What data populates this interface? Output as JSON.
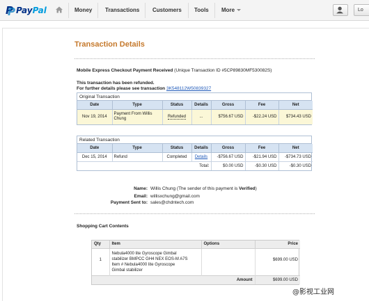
{
  "nav": {
    "logo_pay": "Pay",
    "logo_pal": "Pal",
    "items": [
      "Money",
      "Transactions",
      "Customers",
      "Tools",
      "More"
    ],
    "logout_label": "Lo"
  },
  "page": {
    "title": "Transaction Details",
    "received_bold": "Mobile Express Checkout Payment Received",
    "received_rest": " (Unique Transaction ID #5CP89830MF530082S)",
    "refunded_note": "This transaction has been refunded.",
    "further_details": "For further details please see transaction ",
    "refund_txn_link": "3K548112W50839327"
  },
  "original": {
    "caption": "Original Transaction",
    "headers": [
      "Date",
      "Type",
      "Status",
      "Details",
      "Gross",
      "Fee",
      "Net"
    ],
    "row": {
      "date": "Nov 19, 2014",
      "type_line1": "Payment From Willis",
      "type_line2": "Chung",
      "status": "Refunded",
      "details": "...",
      "gross": "$756.67 USD",
      "fee": "-$22.24 USD",
      "net": "$734.43 USD"
    }
  },
  "related": {
    "caption": "Related Transaction",
    "headers": [
      "Date",
      "Type",
      "Status",
      "Details",
      "Gross",
      "Fee",
      "Net"
    ],
    "row": {
      "date": "Dec 15, 2014",
      "type": "Refund",
      "status": "Completed",
      "details": "Details",
      "gross": "-$756.67 USD",
      "fee": "-$21.94 USD",
      "net": "-$734.73 USD"
    },
    "total": {
      "label": "Total:",
      "gross": "$0.00 USD",
      "fee": "-$0.30 USD",
      "net": "-$0.30 USD"
    }
  },
  "payer": {
    "name_label": "Name:",
    "name_value": "Willis Chung (The sender of this payment is ",
    "name_verified": "Verified",
    "name_close": ")",
    "email_label": "Email:",
    "email_value": "willisxchung@gmail.com",
    "sent_label": "Payment Sent to:",
    "sent_value": "sales@chdntech.com"
  },
  "cart": {
    "title": "Shopping Cart Contents",
    "headers": [
      "Qty",
      "Item",
      "Options",
      "Price"
    ],
    "row": {
      "qty": "1",
      "item_l1": "Nebula4000 lite Gyroscope Gimbal",
      "item_l2": "stabilizer BMPCC GH4 NEX EOS-M A7S",
      "item_l3": "Item # Nebula4000 lite Gyroscope",
      "item_l4": "Gimbal stabilizer",
      "options": "",
      "price": "$699.00 USD"
    },
    "amount_label": "Amount",
    "amount_value": "$699.00 USD"
  },
  "watermark": "@影视工业网"
}
